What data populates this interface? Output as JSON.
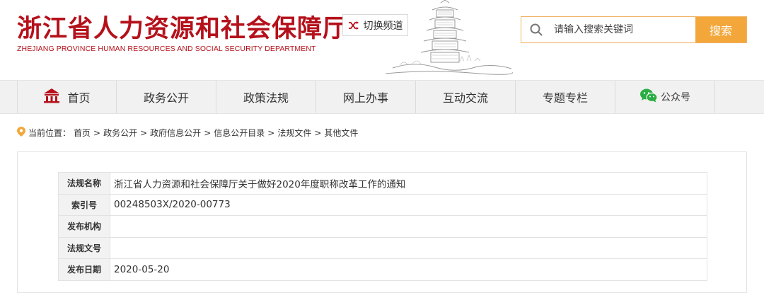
{
  "header": {
    "title": "浙江省人力资源和社会保障厅",
    "subtitle": "ZHEJIANG PROVINCE HUMAN RESOURCES AND SOCIAL SECURITY DEPARTMENT",
    "switch_label": "切换频道",
    "brand_color": "#b5111b"
  },
  "search": {
    "placeholder": "请输入搜索关键词",
    "button_label": "搜索",
    "accent_color": "#f3a73b"
  },
  "nav": {
    "items": [
      {
        "label": "首页",
        "icon": "home-icon"
      },
      {
        "label": "政务公开"
      },
      {
        "label": "政策法规"
      },
      {
        "label": "网上办事"
      },
      {
        "label": "互动交流"
      },
      {
        "label": "专题专栏"
      },
      {
        "label": "公众号",
        "icon": "wechat-icon"
      }
    ]
  },
  "breadcrumb": {
    "prefix": "当前位置：",
    "items": [
      "首页",
      "政务公开",
      "政府信息公开",
      "信息公开目录",
      "法规文件",
      "其他文件"
    ]
  },
  "meta": {
    "rows": [
      {
        "label": "法规名称",
        "value": "浙江省人力资源和社会保障厅关于做好2020年度职称改革工作的通知"
      },
      {
        "label": "索引号",
        "value": "00248503X/2020-00773"
      },
      {
        "label": "发布机构",
        "value": ""
      },
      {
        "label": "法规文号",
        "value": ""
      },
      {
        "label": "发布日期",
        "value": "2020-05-20"
      }
    ]
  }
}
